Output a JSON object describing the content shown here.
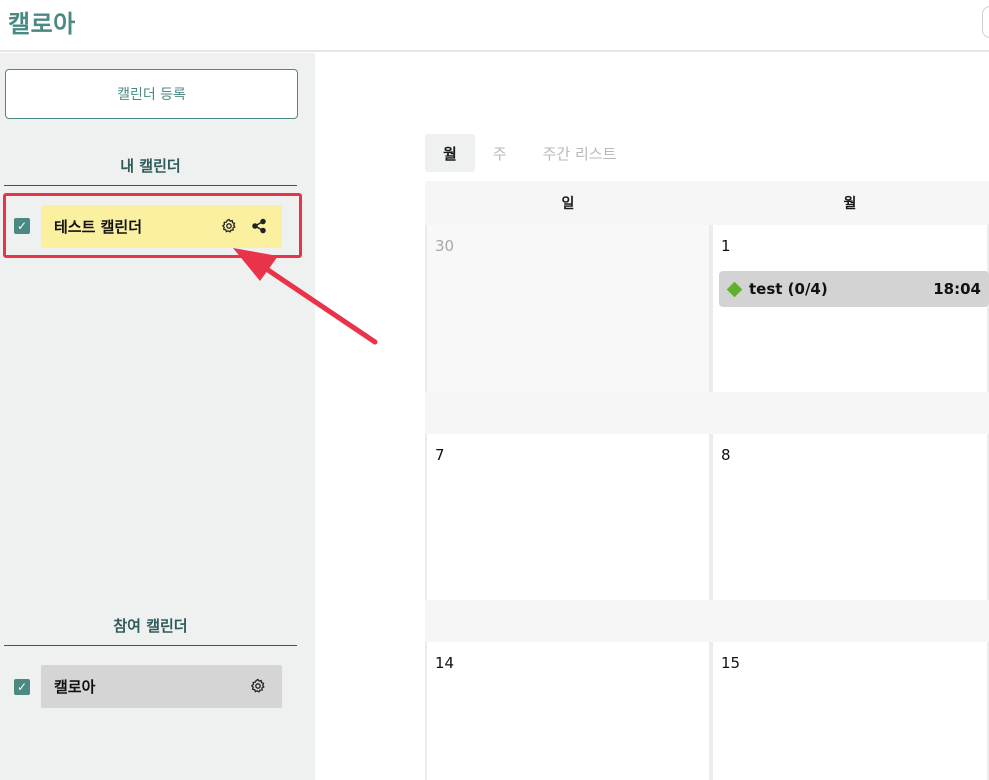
{
  "header": {
    "logo": "캘로아"
  },
  "sidebar": {
    "register_button": "캘린더 등록",
    "my_calendars_title": "내 캘린더",
    "my_calendars": [
      {
        "name": "테스트 캘린더",
        "checked": true,
        "color": "#fbf0a0",
        "icons": [
          "gear-icon",
          "share-icon"
        ]
      }
    ],
    "joined_calendars_title": "참여 캘린더",
    "joined_calendars": [
      {
        "name": "캘로아",
        "checked": true,
        "color": "#d5d5d5",
        "icons": [
          "gear-icon"
        ]
      }
    ],
    "checkmark": "✓"
  },
  "main": {
    "tabs": [
      {
        "label": "월",
        "active": true
      },
      {
        "label": "주",
        "active": false
      },
      {
        "label": "주간 리스트",
        "active": false
      }
    ],
    "weekday_headers": [
      "일",
      "월"
    ],
    "weeks": [
      {
        "dates": [
          "30",
          "1"
        ],
        "muted": [
          true,
          false
        ]
      },
      {
        "dates": [
          "7",
          "8"
        ],
        "muted": [
          false,
          false
        ]
      },
      {
        "dates": [
          "14",
          "15"
        ],
        "muted": [
          false,
          false
        ]
      }
    ],
    "events": [
      {
        "title": "test (0/4)",
        "time": "18:04",
        "color": "#5fb02e"
      }
    ]
  },
  "colors": {
    "accent": "#4a8a83",
    "annotation": "#e8334a"
  }
}
